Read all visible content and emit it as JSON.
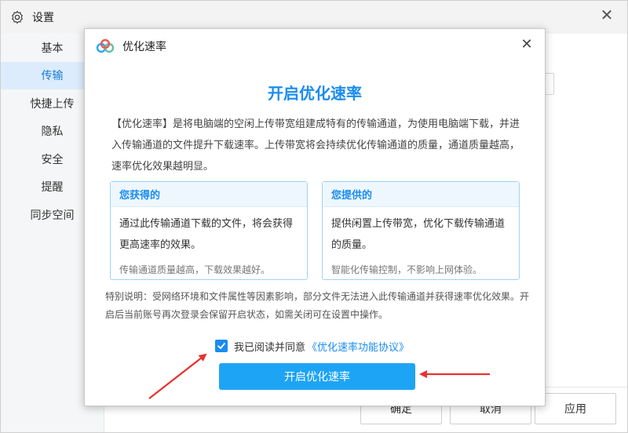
{
  "settings": {
    "title": "设置",
    "close_glyph": "✕",
    "sidebar": {
      "items": [
        {
          "label": "基本",
          "active": false
        },
        {
          "label": "传输",
          "active": true
        },
        {
          "label": "快捷上传",
          "active": false
        },
        {
          "label": "隐私",
          "active": false
        },
        {
          "label": "安全",
          "active": false
        },
        {
          "label": "提醒",
          "active": false
        },
        {
          "label": "同步空间",
          "active": false
        }
      ]
    },
    "footer": {
      "confirm_label": "确定",
      "cancel_label": "取消",
      "apply_label": "应用"
    }
  },
  "modal": {
    "title": "优化速率",
    "close_glyph": "✕",
    "heading": "开启优化速率",
    "description": "【优化速率】是将电脑端的空闲上传带宽组建成特有的传输通道，为使用电脑端下载，并进入传输通道的文件提升下载速率。上传带宽将会持续优化传输通道的质量，通道质量越高，速率优化效果越明显。",
    "you_get": {
      "title": "您获得的",
      "main": "通过此传输通道下载的文件，将会获得更高速率的效果。",
      "note": "传输通道质量越高，下载效果越好。"
    },
    "you_provide": {
      "title": "您提供的",
      "main": "提供闲置上传带宽，优化下载传输通道的质量。",
      "note": "智能化传输控制，不影响上网体验。"
    },
    "special_note": "特别说明：受网络环境和文件属性等因素影响，部分文件无法进入此传输通道并获得速率优化效果。开启后当前账号再次登录会保留开启状态，如需关闭可在设置中操作。",
    "agree": {
      "checked": true,
      "text": "我已阅读并同意",
      "link": "《优化速率功能协议》"
    },
    "primary_button": "开启优化速率"
  },
  "colors": {
    "accent": "#1a8cf0",
    "button": "#1ea4f5",
    "arrow": "#e8322f",
    "sidebar_active": "#dcecfc"
  }
}
